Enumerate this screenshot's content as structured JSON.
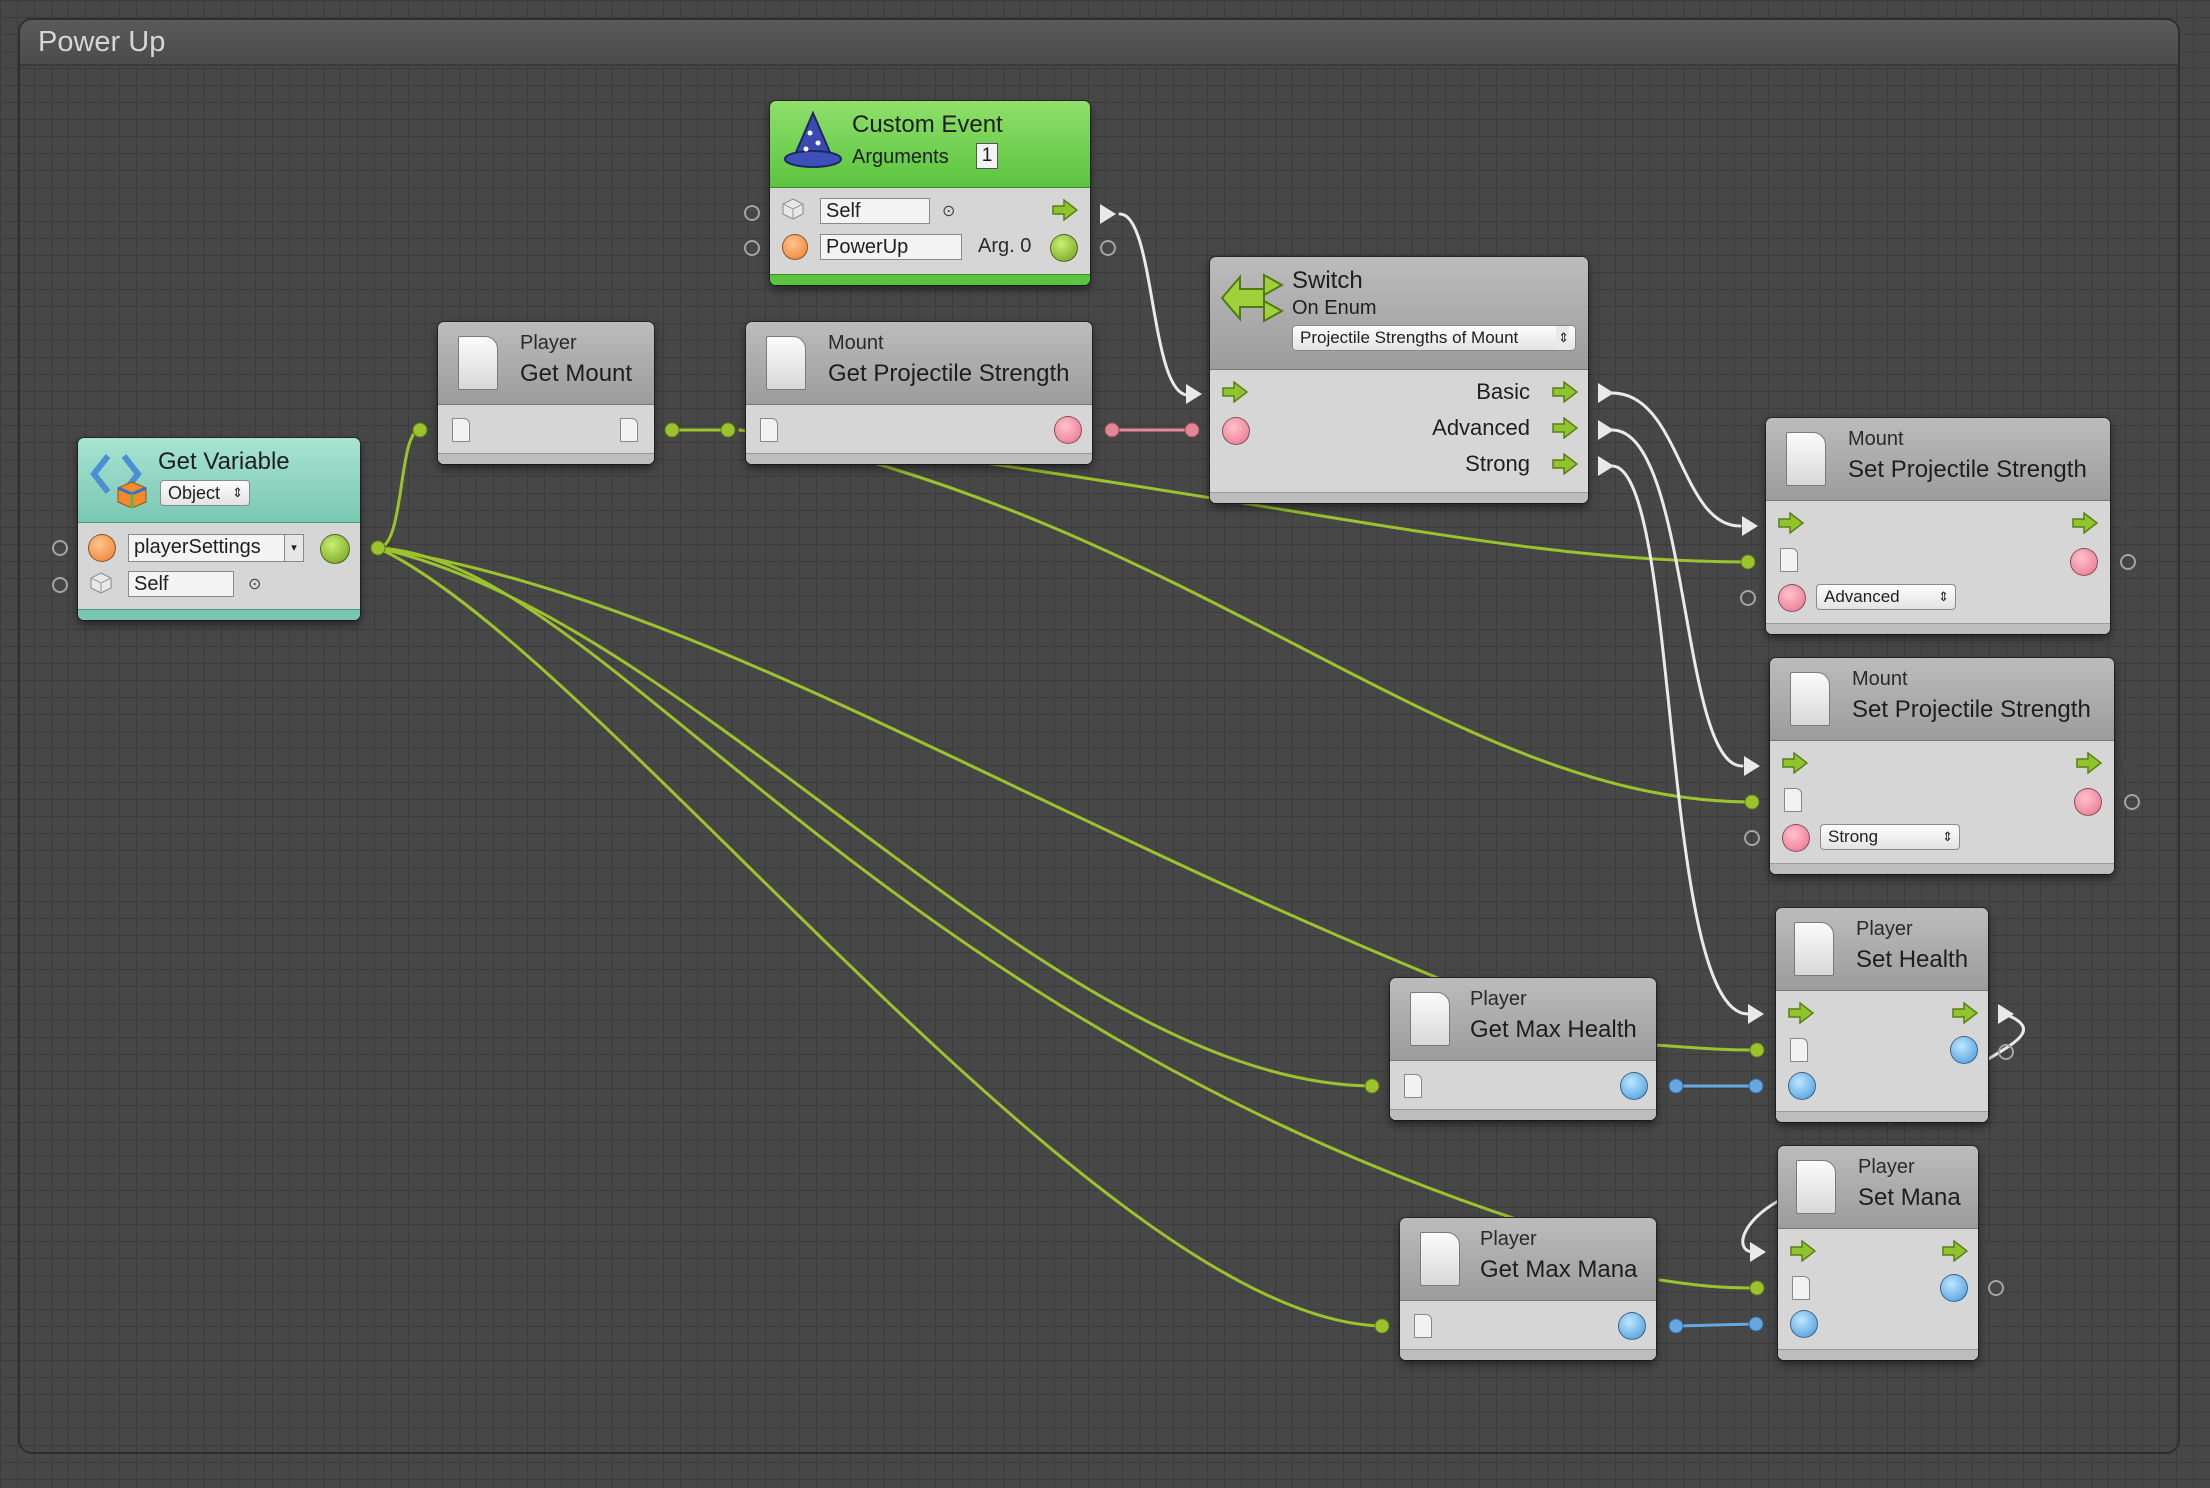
{
  "graph": {
    "title": "Power Up"
  },
  "nodes": {
    "custom_event": {
      "title": "Custom Event",
      "args_label": "Arguments",
      "args_count": "1",
      "self_value": "Self",
      "event_value": "PowerUp",
      "arg_label": "Arg. 0"
    },
    "get_variable": {
      "title": "Get Variable",
      "type": "Object",
      "var_name": "playerSettings",
      "self_value": "Self"
    },
    "get_mount": {
      "target": "Player",
      "name": "Get Mount"
    },
    "get_projectile_strength": {
      "target": "Mount",
      "name": "Get Projectile Strength"
    },
    "switch": {
      "title": "Switch",
      "subtitle": "On Enum",
      "enum": "Projectile Strengths of Mount",
      "cases": [
        "Basic",
        "Advanced",
        "Strong"
      ]
    },
    "set_strength_1": {
      "target": "Mount",
      "name": "Set Projectile Strength",
      "value": "Advanced"
    },
    "set_strength_2": {
      "target": "Mount",
      "name": "Set Projectile Strength",
      "value": "Strong"
    },
    "get_max_health": {
      "target": "Player",
      "name": "Get Max Health"
    },
    "set_health": {
      "target": "Player",
      "name": "Set Health"
    },
    "get_max_mana": {
      "target": "Player",
      "name": "Get Max Mana"
    },
    "set_mana": {
      "target": "Player",
      "name": "Set Mana"
    }
  },
  "colors": {
    "object_wire": "#9ac32d",
    "float_wire": "#67a7e0",
    "enum_wire": "#e38796",
    "flow_wire": "#eaeaea"
  }
}
